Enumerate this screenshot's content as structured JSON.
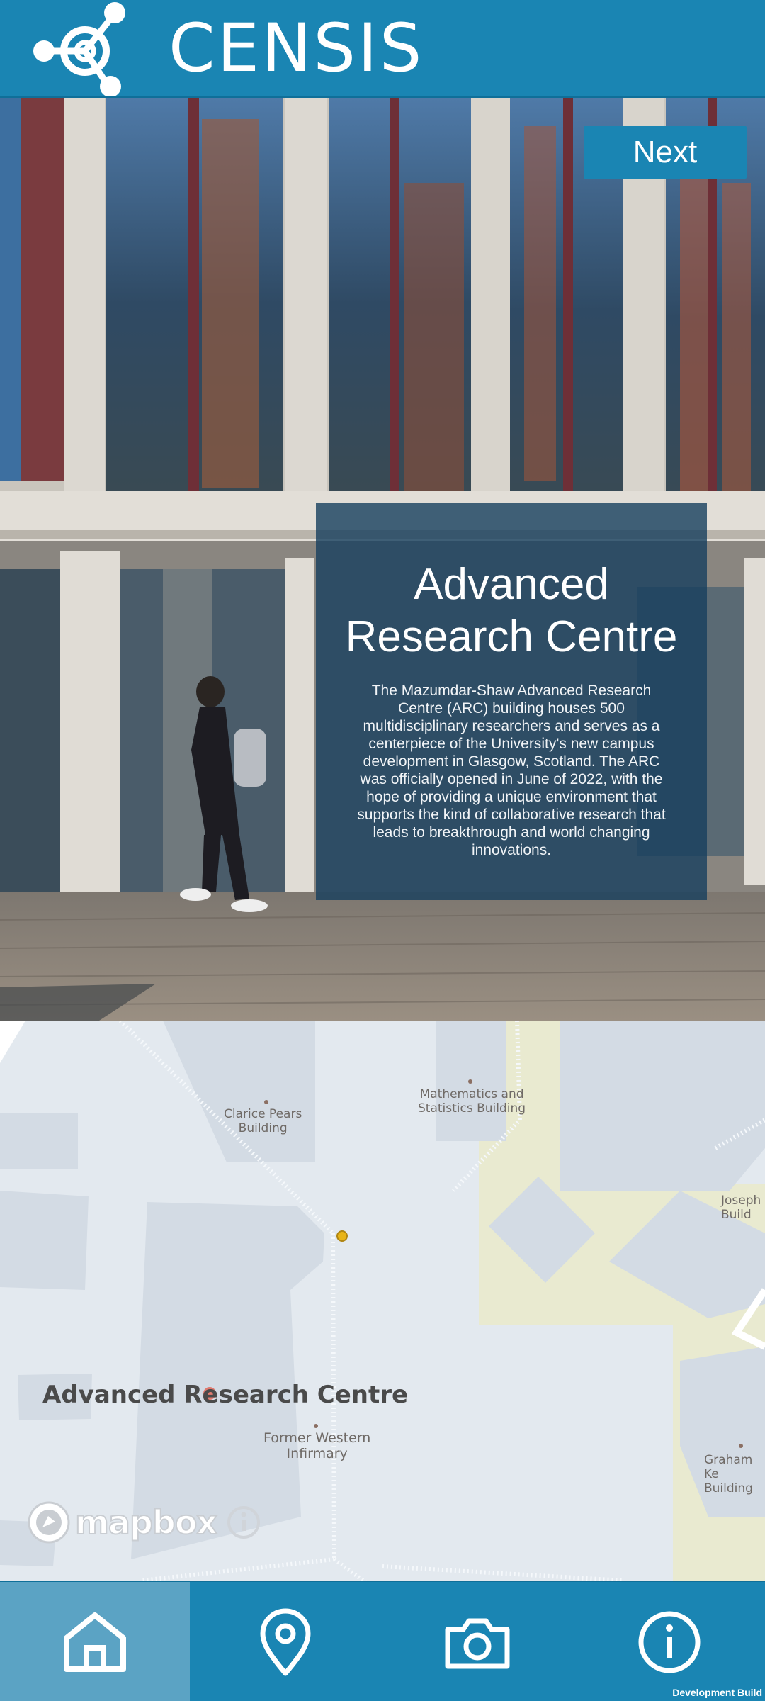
{
  "header": {
    "brand": "CENSIS",
    "logo_icon": "censis-logo-icon"
  },
  "hero": {
    "next_label": "Next",
    "card": {
      "title": "Advanced Research Centre",
      "body": "The Mazumdar-Shaw Advanced Research Centre (ARC) building houses 500 multidisciplinary researchers and serves as a centerpiece of the University's new campus development in Glasgow, Scotland. The ARC was officially opened in June of 2022, with the hope of providing a unique environment that supports the kind of collaborative research that leads to breakthrough and world changing innovations."
    }
  },
  "map": {
    "labels": {
      "clarice": "Clarice Pears\nBuilding",
      "maths": "Mathematics and\nStatistics Building",
      "joseph": "Joseph\nBuild",
      "graham": "Graham Ke\nBuilding",
      "western": "Former Western\nInfirmary",
      "arc": "Advanced Research Centre"
    },
    "attribution": "mapbox",
    "colors": {
      "land": "#e3e9ef",
      "building": "#d3dbe4",
      "park": "#e9ead0",
      "path": "#f5f8fb"
    }
  },
  "nav": {
    "tabs": [
      {
        "name": "home",
        "icon": "home-icon",
        "active": true
      },
      {
        "name": "location",
        "icon": "map-pin-icon",
        "active": false
      },
      {
        "name": "camera",
        "icon": "camera-icon",
        "active": false
      },
      {
        "name": "info",
        "icon": "info-icon",
        "active": false
      }
    ]
  },
  "build_label": "Development Build",
  "colors": {
    "primary": "#1a85b3",
    "active_tab": "#5ba3c4",
    "card": "#163e5e"
  }
}
